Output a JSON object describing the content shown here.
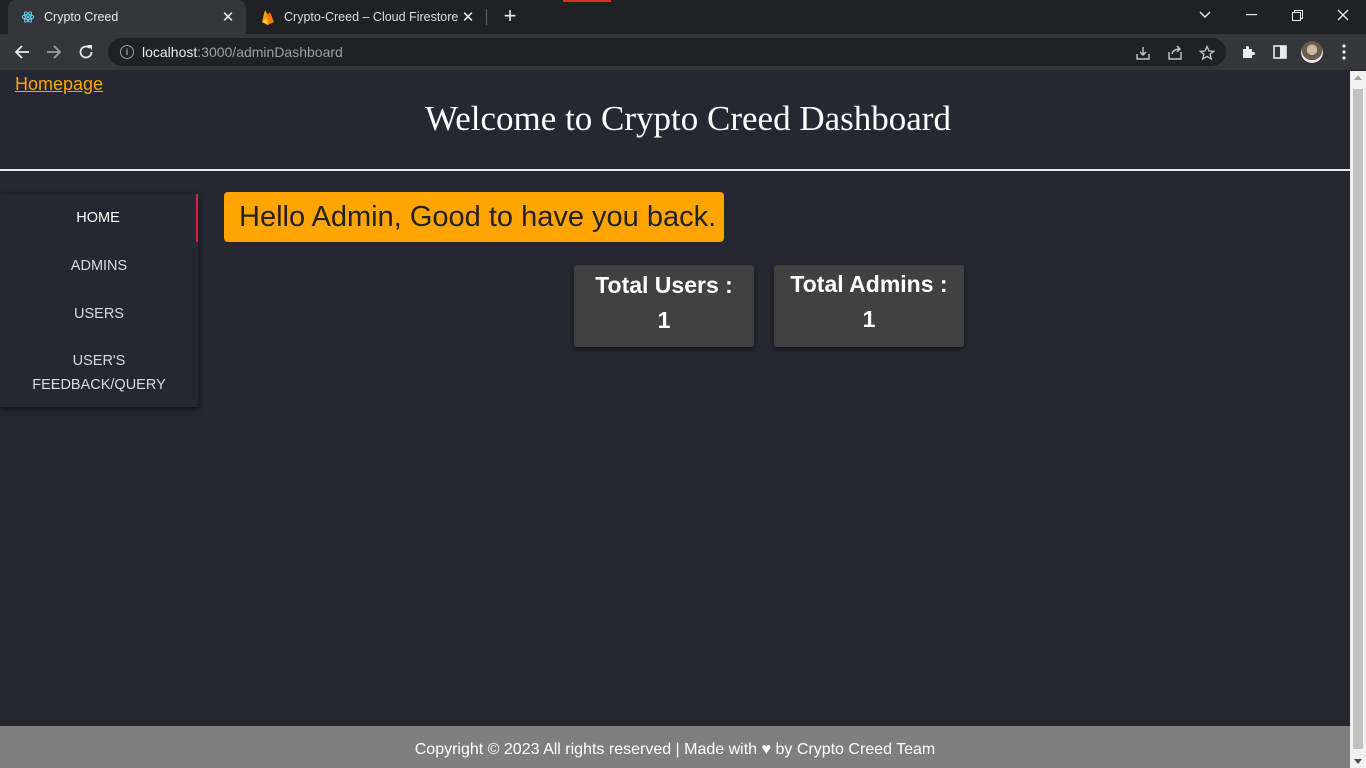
{
  "browser": {
    "tabs": [
      {
        "title": "Crypto Creed",
        "icon": "react-icon",
        "active": true
      },
      {
        "title": "Crypto-Creed – Cloud Firestore –",
        "icon": "firebase-icon",
        "active": false
      }
    ],
    "url_host": "localhost",
    "url_rest": ":3000/adminDashboard"
  },
  "page": {
    "homepage_link": "Homepage",
    "heading": "Welcome to Crypto Creed Dashboard",
    "greeting": "Hello Admin, Good to have you back."
  },
  "sidebar": {
    "items": [
      {
        "label": "HOME",
        "active": true
      },
      {
        "label": "ADMINS"
      },
      {
        "label": "USERS"
      },
      {
        "label_line1": "USER'S",
        "label_line2": "FEEDBACK/QUERY"
      }
    ]
  },
  "stats": [
    {
      "label": "Total Users :",
      "value": "1"
    },
    {
      "label": "Total Admins :",
      "value": "1"
    }
  ],
  "footer": {
    "text": "Copyright © 2023 All rights reserved | Made with ♥ by Crypto Creed Team"
  },
  "colors": {
    "background": "#252831",
    "accent": "#ffa500",
    "active_indicator": "#e6194b",
    "card": "#414141",
    "footer": "#7f7f7f"
  }
}
